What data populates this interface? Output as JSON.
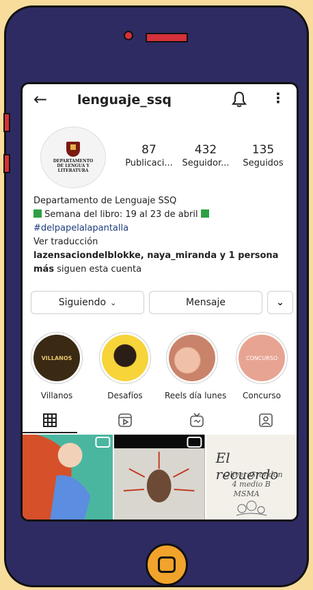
{
  "profile": {
    "username": "lenguaje_ssq",
    "avatar_title": "DEPARTAMENTO DE LENGUA Y LITERATURA",
    "stats": [
      {
        "value": "87",
        "label": "Publicaci..."
      },
      {
        "value": "432",
        "label": "Seguidor..."
      },
      {
        "value": "135",
        "label": "Seguidos"
      }
    ],
    "bio": {
      "name": "Departamento de Lenguaje SSQ",
      "line2": "Semana del libro: 19 al 23 de abril",
      "hashtag": "#delpapelalapantalla",
      "translate": "Ver traducción",
      "followers_bold": "lazensaciondelblokke, naya_miranda y 1 persona",
      "followers_bold2": "más",
      "followers_rest": "siguen esta cuenta"
    }
  },
  "actions": {
    "following": "Siguiendo",
    "message": "Mensaje"
  },
  "highlights": [
    {
      "label": "Villanos",
      "inner_text": "VILLANOS"
    },
    {
      "label": "Desafíos",
      "inner_text": ""
    },
    {
      "label": "Reels día lunes",
      "inner_text": ""
    },
    {
      "label": "Concurso",
      "inner_text": "CONCURSO"
    }
  ],
  "posts": {
    "post3_title": "El recuerdo",
    "post3_sub1": "Oliver Grandon",
    "post3_sub2": "4 medio B",
    "post3_sub3": "MSMA"
  },
  "icons": [
    "back-arrow-icon",
    "bell-icon",
    "more-icon",
    "chevron-down-icon",
    "grid-icon",
    "reels-icon",
    "igtv-icon",
    "tagged-icon",
    "phone-home-icon"
  ],
  "colors": {
    "phone_body": "#2e2b63",
    "background": "#f8dc9c",
    "accent_red": "#d6303a",
    "home_button": "#f1a32c",
    "hashtag": "#1e3e7b",
    "green_square": "#2ea043"
  }
}
